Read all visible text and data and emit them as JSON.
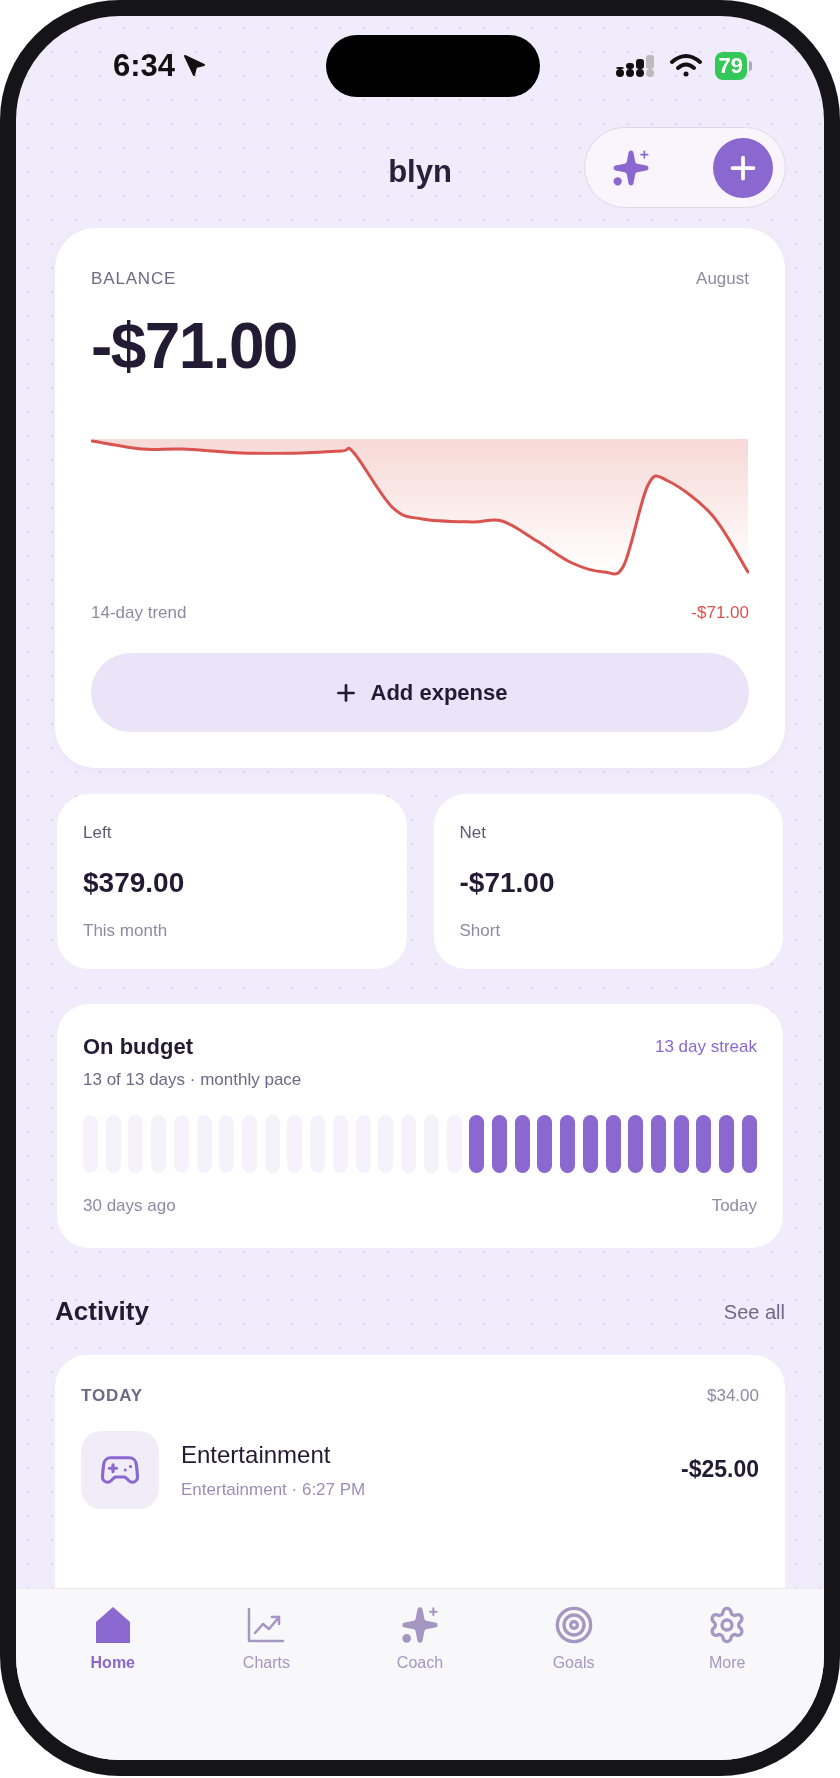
{
  "status_bar": {
    "time": "6:34",
    "battery": "79"
  },
  "header": {
    "title": "blyn"
  },
  "balance": {
    "label": "BALANCE",
    "month": "August",
    "amount": "-$71.00",
    "trend_label": "14-day trend",
    "trend_end": "-$71.00",
    "add_button": "Add expense"
  },
  "stats": [
    {
      "label": "Left",
      "value": "$379.00",
      "caption": "This month"
    },
    {
      "label": "Net",
      "value": "-$71.00",
      "caption": "Short"
    }
  ],
  "budget": {
    "title": "On budget",
    "subtitle": "13 of 13 days · monthly pace",
    "streak": "13 day streak",
    "start_label": "30 days ago",
    "end_label": "Today",
    "days": [
      {
        "on": false
      },
      {
        "on": false
      },
      {
        "on": false
      },
      {
        "on": false
      },
      {
        "on": false
      },
      {
        "on": false
      },
      {
        "on": false
      },
      {
        "on": false
      },
      {
        "on": false
      },
      {
        "on": false
      },
      {
        "on": false
      },
      {
        "on": false
      },
      {
        "on": false
      },
      {
        "on": false
      },
      {
        "on": false
      },
      {
        "on": false
      },
      {
        "on": false
      },
      {
        "on": true
      },
      {
        "on": true
      },
      {
        "on": true
      },
      {
        "on": true
      },
      {
        "on": true
      },
      {
        "on": true
      },
      {
        "on": true
      },
      {
        "on": true
      },
      {
        "on": true
      },
      {
        "on": true
      },
      {
        "on": true
      },
      {
        "on": true
      },
      {
        "on": true
      }
    ]
  },
  "activity": {
    "title": "Activity",
    "see_all": "See all",
    "groups": [
      {
        "label": "TODAY",
        "total": "$34.00",
        "items": [
          {
            "title": "Entertainment",
            "subtitle": "Entertainment · 6:27 PM",
            "amount": "-$25.00"
          }
        ]
      }
    ]
  },
  "tabs": [
    {
      "label": "Home",
      "selected": true
    },
    {
      "label": "Charts",
      "selected": false
    },
    {
      "label": "Coach",
      "selected": false
    },
    {
      "label": "Goals",
      "selected": false
    },
    {
      "label": "More",
      "selected": false
    }
  ]
}
